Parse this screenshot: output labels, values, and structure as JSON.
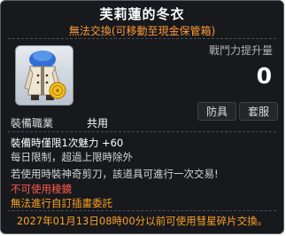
{
  "item": {
    "name": "芙莉蓮的冬衣",
    "trade_notice": "無法交換(可移動至現金保管箱)"
  },
  "stats": {
    "power_label": "戰鬥力提升量",
    "power_value": "0"
  },
  "job": {
    "label": "裝備職業",
    "value": "共用"
  },
  "buttons": {
    "armor": "防具",
    "set": "套服"
  },
  "effects": {
    "equip_limit": "裝備時僅限1次魅力 +60",
    "daily_limit": "每日限制，超過上限時除外",
    "scissors": "若使用時裝神奇剪刀，該道具可進行一次交易!",
    "no_prism": "不可使用稜鏡",
    "no_consign": "無法進行自訂插畫委託"
  },
  "footer": "2027年01月13日08時00分以前可使用彗星碎片交換。",
  "icons": {
    "item_image": "winter-coat-item-icon"
  }
}
